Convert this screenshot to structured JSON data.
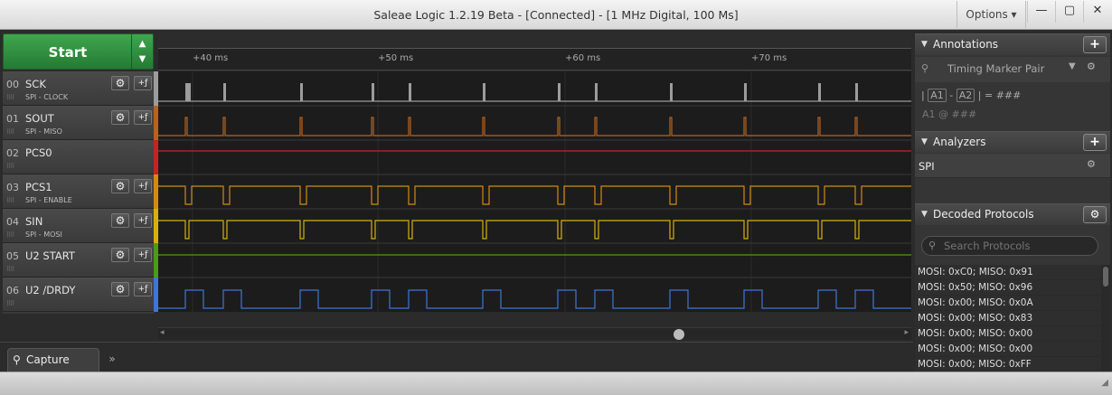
{
  "window": {
    "title": "Saleae Logic 1.2.19 Beta - [Connected] - [1 MHz Digital, 100 Ms]",
    "options_label": "Options ▾",
    "minimize_glyph": "—",
    "maximize_glyph": "▢",
    "close_glyph": "✕"
  },
  "start_button": {
    "label": "Start",
    "up_glyph": "▲",
    "down_glyph": "▼"
  },
  "channels": [
    {
      "num": "00",
      "name": "SCK",
      "sub": "SPI - CLOCK",
      "color": "#9c9c9c"
    },
    {
      "num": "01",
      "name": "SOUT",
      "sub": "SPI - MISO",
      "color": "#b8621d"
    },
    {
      "num": "02",
      "name": "PCS0",
      "sub": "",
      "color": "#c42424"
    },
    {
      "num": "03",
      "name": "PCS1",
      "sub": "SPI - ENABLE",
      "color": "#d48a10"
    },
    {
      "num": "04",
      "name": "SIN",
      "sub": "SPI - MOSI",
      "color": "#d6b10c"
    },
    {
      "num": "05",
      "name": "U2 START",
      "sub": "",
      "color": "#4c9a18"
    },
    {
      "num": "06",
      "name": "U2 /DRDY",
      "sub": "",
      "color": "#3d76d6"
    }
  ],
  "ruler": {
    "ticks": [
      "+40 ms",
      "+50 ms",
      "+60 ms",
      "+70 ms"
    ]
  },
  "bottom": {
    "capture_label": "Capture",
    "more_glyph": "»"
  },
  "annotations": {
    "title": "Annotations",
    "marker_label": "Timing Marker Pair",
    "formula_a1": "A1",
    "formula_a2": "A2",
    "formula_value": "= ###",
    "a1_line": "A1  @  ###"
  },
  "analyzers": {
    "title": "Analyzers",
    "items": [
      "SPI"
    ]
  },
  "decoded": {
    "title": "Decoded Protocols",
    "search_placeholder": "Search Protocols",
    "rows": [
      "MOSI: 0xC0;  MISO: 0x91",
      "MOSI: 0x50;  MISO: 0x96",
      "MOSI: 0x00;  MISO: 0x0A",
      "MOSI: 0x00;  MISO: 0x83",
      "MOSI: 0x00;  MISO: 0x00",
      "MOSI: 0x00;  MISO: 0x00",
      "MOSI: 0x00;  MISO: 0xFF"
    ]
  }
}
